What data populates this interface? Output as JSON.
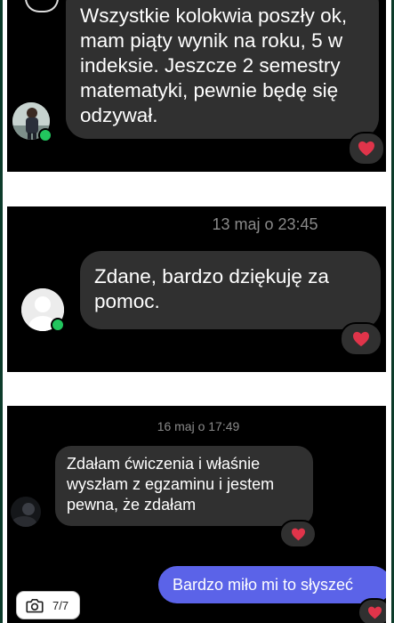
{
  "panel1": {
    "message": "Wszystkie kolokwia poszły ok,\nmam piąty wynik na roku, 5 w\nindeksie. Jeszcze 2 semestry\nmatematyki, pewnie będę się\nodzywał."
  },
  "panel2": {
    "timestamp": "13 maj o 23:45",
    "message": "Zdane, bardzo dziękuję za\npomoc."
  },
  "panel3": {
    "timestamp": "16 maj o 17:49",
    "received_message": "Zdałam ćwiczenia i właśnie\nwyszłam z egzaminu i jestem\npewna, że zdałam",
    "sent_message": "Bardzo miło mi to słyszeć"
  },
  "gallery_counter": {
    "label": "7/7",
    "icon": "camera-icon"
  },
  "colors": {
    "bubble_received": "#303030",
    "bubble_sent": "#5b63e8",
    "heart": "#e0344a",
    "online": "#22c55e"
  }
}
